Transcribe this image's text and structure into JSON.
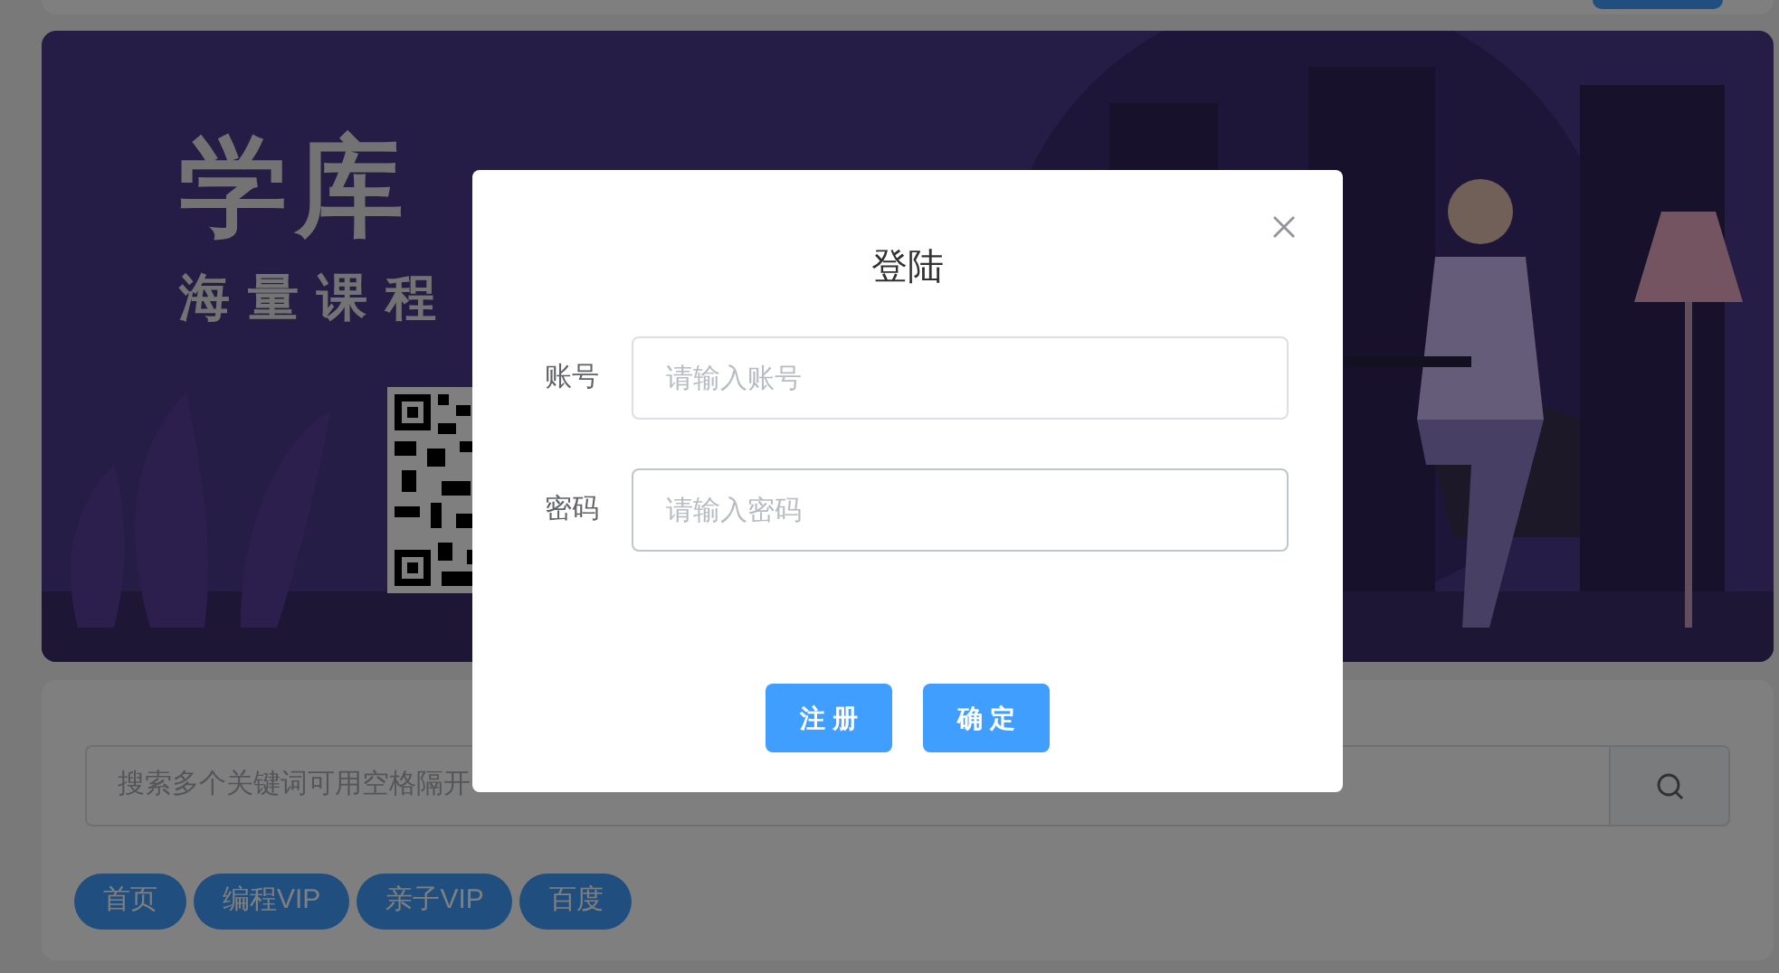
{
  "banner": {
    "title": "学库",
    "subtitle": "海量课程"
  },
  "search": {
    "placeholder": "搜索多个关键词可用空格隔开"
  },
  "tags": [
    {
      "label": "首页"
    },
    {
      "label": "编程VIP"
    },
    {
      "label": "亲子VIP"
    },
    {
      "label": "百度"
    }
  ],
  "dialog": {
    "title": "登陆",
    "fields": [
      {
        "label": "账号",
        "placeholder": "请输入账号",
        "kind": "text"
      },
      {
        "label": "密码",
        "placeholder": "请输入密码",
        "kind": "password"
      }
    ],
    "buttons": [
      {
        "label": "注 册"
      },
      {
        "label": "确 定"
      }
    ]
  }
}
